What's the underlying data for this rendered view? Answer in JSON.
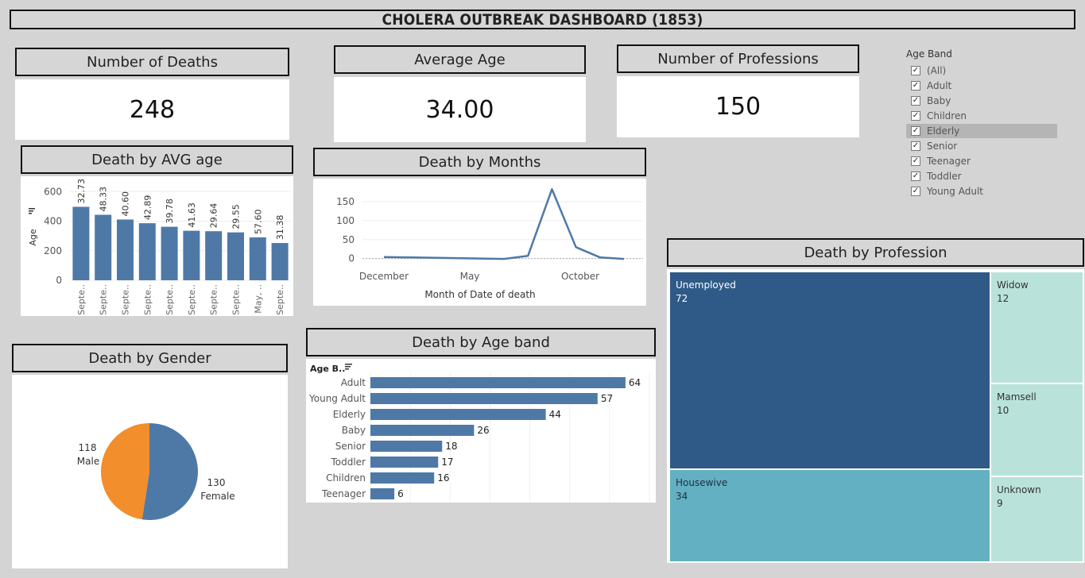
{
  "title": "CHOLERA OUTBREAK DASHBOARD (1853)",
  "kpis": {
    "deaths": {
      "label": "Number of Deaths",
      "value": "248"
    },
    "avg_age": {
      "label": "Average Age",
      "value": "34.00"
    },
    "professions": {
      "label": "Number of Professions",
      "value": "150"
    }
  },
  "filter": {
    "title": "Age Band",
    "items": [
      {
        "label": "(All)",
        "checked": true,
        "selected": false
      },
      {
        "label": "Adult",
        "checked": true,
        "selected": false
      },
      {
        "label": "Baby",
        "checked": true,
        "selected": false
      },
      {
        "label": "Children",
        "checked": true,
        "selected": false
      },
      {
        "label": "Elderly",
        "checked": true,
        "selected": true
      },
      {
        "label": "Senior",
        "checked": true,
        "selected": false
      },
      {
        "label": "Teenager",
        "checked": true,
        "selected": false
      },
      {
        "label": "Toddler",
        "checked": true,
        "selected": false
      },
      {
        "label": "Young Adult",
        "checked": true,
        "selected": false
      }
    ]
  },
  "colors": {
    "bar": "#4e79a7",
    "female": "#4e79a7",
    "male": "#f28e2b",
    "tm_dark": "#2f5a87",
    "tm_mid": "#62b0c2",
    "tm_light": "#b9e3da"
  },
  "chart_data": [
    {
      "id": "avg_age",
      "title": "Death by AVG age",
      "type": "bar",
      "ylabel": "Age",
      "yticks": [
        0,
        200,
        400,
        600
      ],
      "ylim": [
        0,
        650
      ],
      "categories": [
        "Septe..",
        "Septe..",
        "Septe..",
        "Septe..",
        "Septe..",
        "Septe..",
        "Septe..",
        "Septe..",
        "May, ..",
        "Septe.."
      ],
      "values": [
        497,
        443,
        411,
        386,
        362,
        335,
        332,
        324,
        290,
        252
      ],
      "data_labels": [
        "32.73",
        "48.33",
        "40.60",
        "42.89",
        "39.78",
        "41.63",
        "29.64",
        "29.55",
        "57.60",
        "31.38"
      ]
    },
    {
      "id": "months",
      "title": "Death by Months",
      "type": "line",
      "xlabel": "Month of Date of death",
      "xtick_labels": [
        "December",
        "May",
        "October"
      ],
      "yticks": [
        0,
        50,
        100,
        150
      ],
      "ylim": [
        -5,
        190
      ],
      "values": [
        4,
        3,
        2,
        1,
        0,
        -1,
        7,
        183,
        30,
        3,
        -1
      ]
    },
    {
      "id": "gender",
      "title": "Death by Gender",
      "type": "pie",
      "slices": [
        {
          "name": "Female",
          "value": 130
        },
        {
          "name": "Male",
          "value": 118
        }
      ]
    },
    {
      "id": "ageband",
      "title": "Death by Age band",
      "type": "bar",
      "orientation": "horizontal",
      "axis_header": "Age B..",
      "xlim": [
        0,
        70
      ],
      "categories": [
        "Adult",
        "Young Adult",
        "Elderly",
        "Baby",
        "Senior",
        "Toddler",
        "Children",
        "Teenager"
      ],
      "values": [
        64,
        57,
        44,
        26,
        18,
        17,
        16,
        6
      ]
    },
    {
      "id": "profession",
      "title": "Death by Profession",
      "type": "treemap",
      "items": [
        {
          "name": "Unemployed",
          "value": 72
        },
        {
          "name": "Housewive",
          "value": 34
        },
        {
          "name": "Widow",
          "value": 12
        },
        {
          "name": "Mamsell",
          "value": 10
        },
        {
          "name": "Unknown",
          "value": 9
        }
      ]
    }
  ]
}
